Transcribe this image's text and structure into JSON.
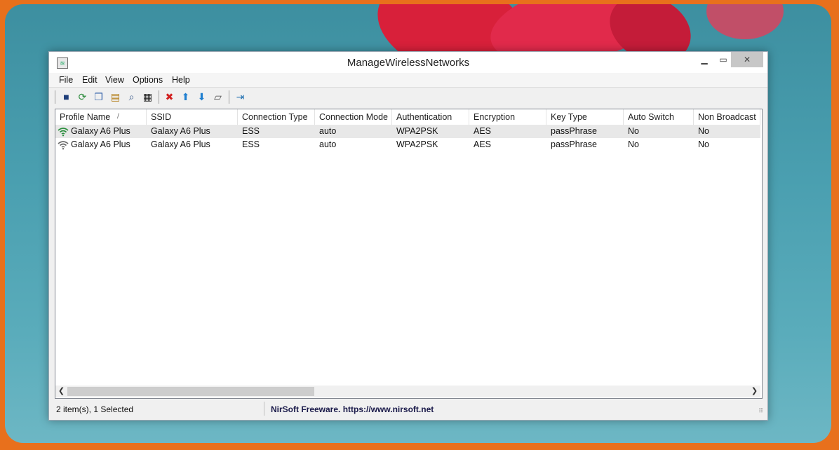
{
  "window": {
    "title": "ManageWirelessNetworks"
  },
  "menu": [
    "File",
    "Edit",
    "View",
    "Options",
    "Help"
  ],
  "toolbar": {
    "icons": [
      "save-icon",
      "refresh-icon",
      "copy-icon",
      "properties-icon",
      "find-icon",
      "qr-code-icon",
      "delete-icon",
      "move-up-icon",
      "move-down-icon",
      "tag-icon",
      "exit-icon"
    ]
  },
  "columns": [
    "Profile Name",
    "SSID",
    "Connection Type",
    "Connection Mode",
    "Authentication",
    "Encryption",
    "Key Type",
    "Auto Switch",
    "Non Broadcast"
  ],
  "sort_indicator": "/",
  "rows": [
    {
      "profile_name": "Galaxy A6 Plus",
      "ssid": "Galaxy A6 Plus",
      "connection_type": "ESS",
      "connection_mode": "auto",
      "authentication": "WPA2PSK",
      "encryption": "AES",
      "key_type": "passPhrase",
      "auto_switch": "No",
      "non_broadcast": "No",
      "icon": "wifi-connected-icon",
      "icon_color": "#2c8f3f",
      "selected": true
    },
    {
      "profile_name": "Galaxy A6 Plus",
      "ssid": "Galaxy A6 Plus",
      "connection_type": "ESS",
      "connection_mode": "auto",
      "authentication": "WPA2PSK",
      "encryption": "AES",
      "key_type": "passPhrase",
      "auto_switch": "No",
      "non_broadcast": "No",
      "icon": "wifi-icon",
      "icon_color": "#6a6a6a",
      "selected": false
    }
  ],
  "status": {
    "items": "2 item(s), 1 Selected",
    "credit": "NirSoft Freeware. https://www.nirsoft.net"
  },
  "colors": {
    "accent_border": "#e8701c",
    "selection": "#e8e8e8"
  }
}
